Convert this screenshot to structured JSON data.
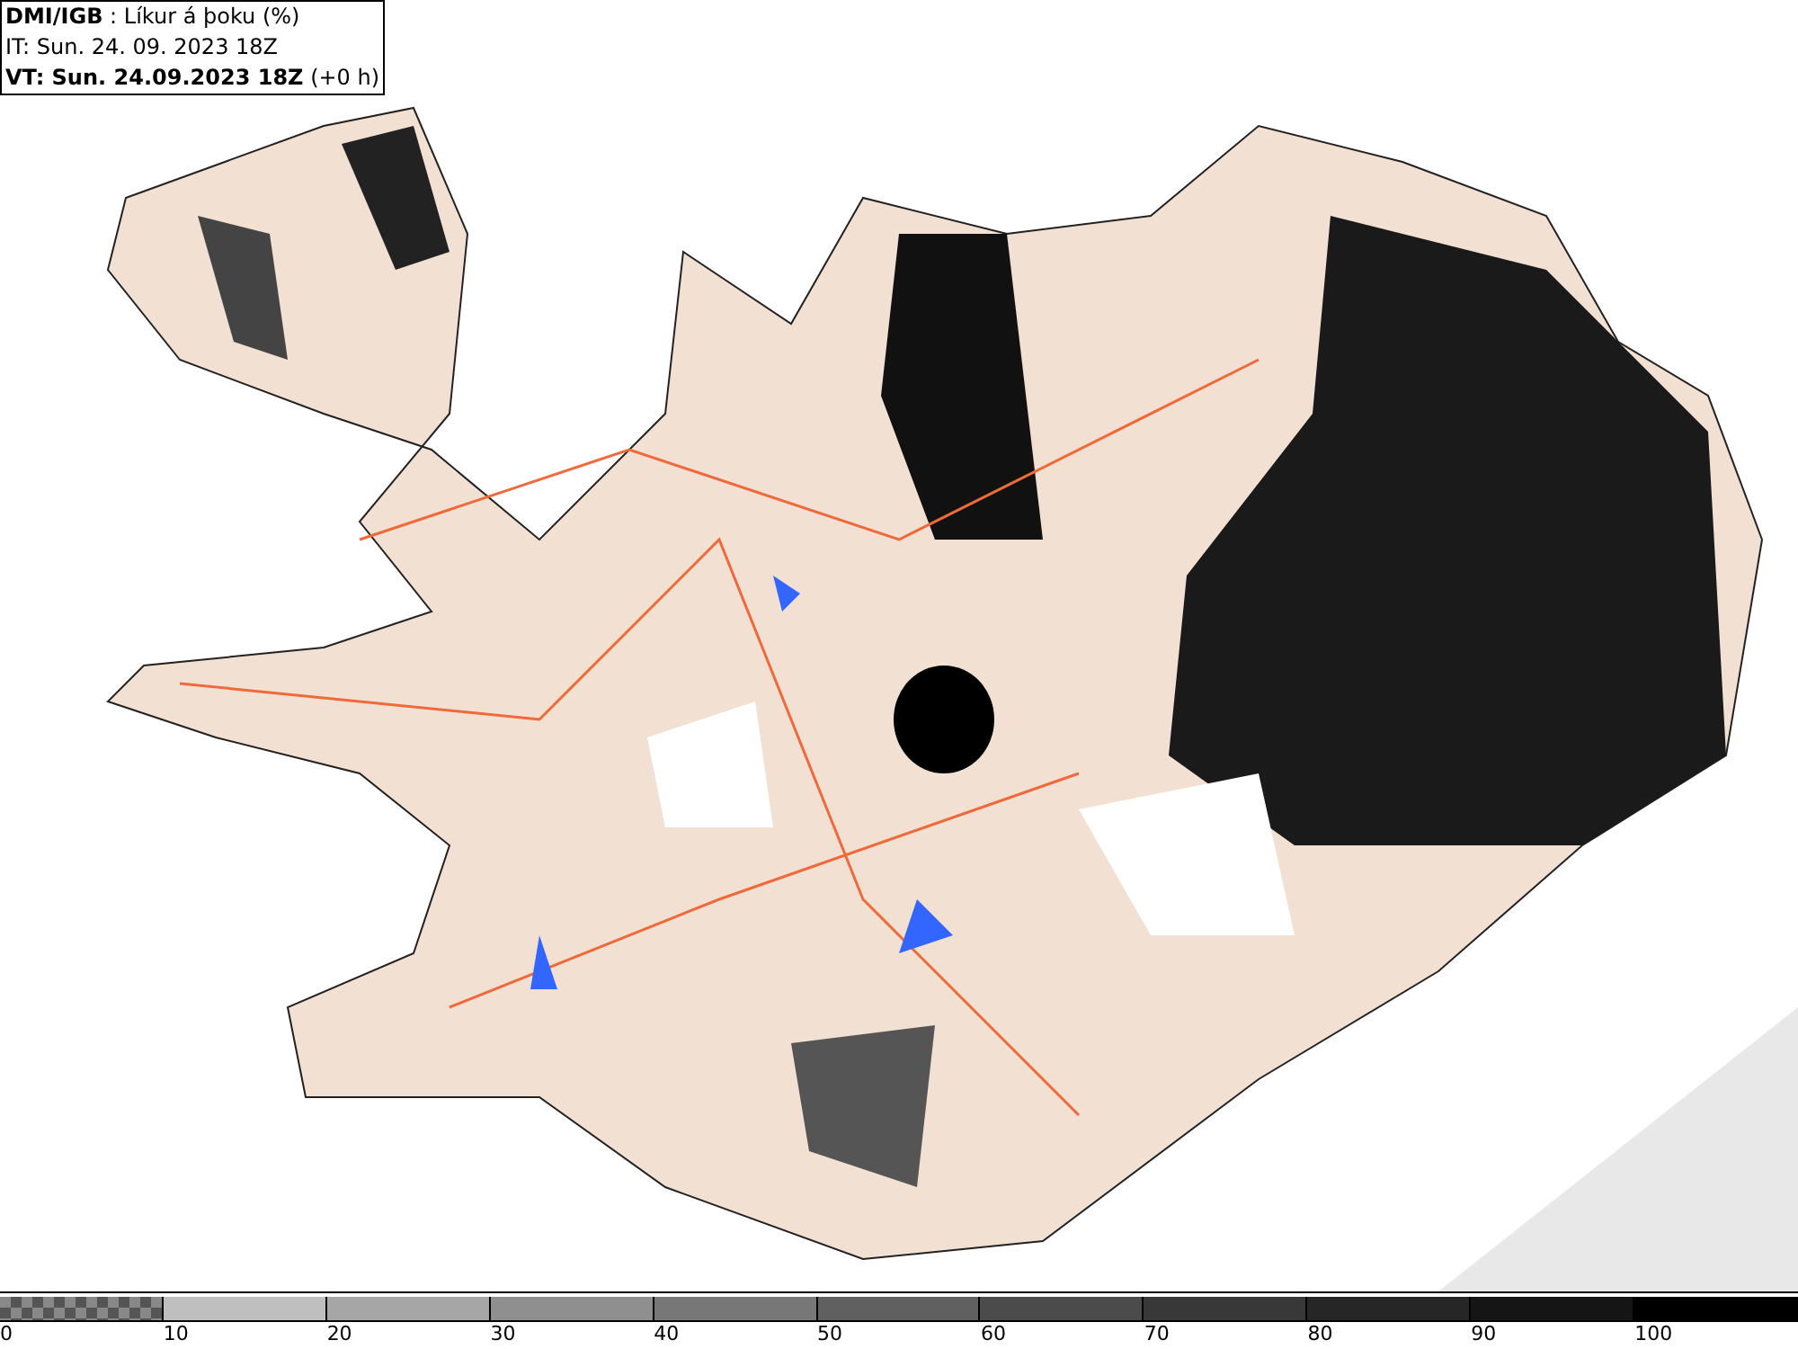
{
  "header": {
    "lines": [
      "**DMI/IGB** : Líkur á þoku (%)",
      "IT: Sun. 24. 09. 2023 18Z",
      "**VT: Sun. 24.09.2023 18Z** (+0 h)"
    ]
  },
  "legend": [
    {
      "kind": "checker",
      "label": "0"
    },
    {
      "kind": "solid",
      "color": "#bfbfbf",
      "label": "10"
    },
    {
      "kind": "solid",
      "color": "#a6a6a6",
      "label": "20"
    },
    {
      "kind": "solid",
      "color": "#8f8f8f",
      "label": "30"
    },
    {
      "kind": "solid",
      "color": "#777777",
      "label": "40"
    },
    {
      "kind": "solid",
      "color": "#606060",
      "label": "50"
    },
    {
      "kind": "solid",
      "color": "#4b4b4b",
      "label": "60"
    },
    {
      "kind": "solid",
      "color": "#383838",
      "label": "70"
    },
    {
      "kind": "solid",
      "color": "#262626",
      "label": "80"
    },
    {
      "kind": "solid",
      "color": "#151515",
      "label": "90"
    },
    {
      "kind": "solid",
      "color": "#000000",
      "label": "100"
    }
  ]
}
